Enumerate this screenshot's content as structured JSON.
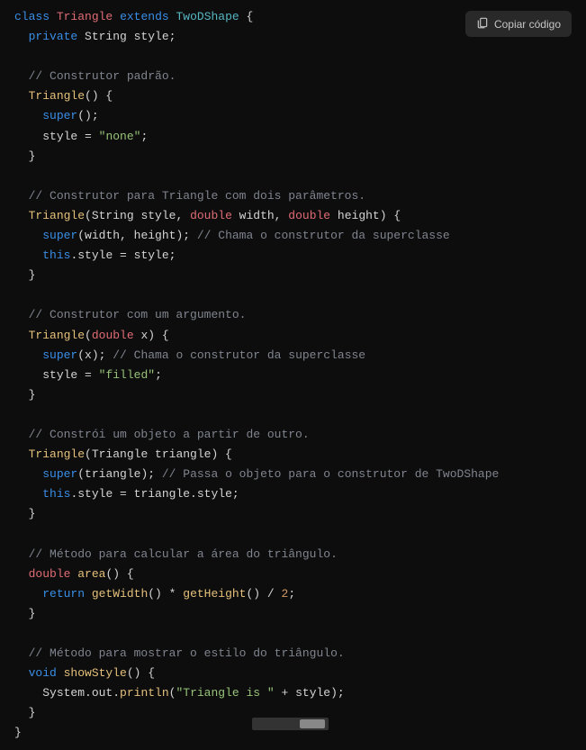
{
  "copyButton": {
    "label": "Copiar código"
  },
  "code": {
    "line1_keyword_class": "class",
    "line1_classname": "Triangle",
    "line1_keyword_extends": "extends",
    "line1_extendsname": "TwoDShape",
    "line1_brace": " {",
    "line2_keyword": "private",
    "line2_type": " String",
    "line2_rest": " style;",
    "line4_comment": "// Construtor padrão.",
    "line5_method": "Triangle",
    "line5_rest": "() {",
    "line6_super": "super",
    "line6_rest": "();",
    "line7_pre": "style = ",
    "line7_string": "\"none\"",
    "line7_post": ";",
    "line8_brace": "}",
    "line10_comment": "// Construtor para Triangle com dois parâmetros.",
    "line11_method": "Triangle",
    "line11_p1": "(String style, ",
    "line11_double1": "double",
    "line11_p2": " width, ",
    "line11_double2": "double",
    "line11_p3": " height) {",
    "line12_super": "super",
    "line12_args": "(width, height); ",
    "line12_comment": "// Chama o construtor da superclasse",
    "line13_this": "this",
    "line13_rest": ".style = style;",
    "line14_brace": "}",
    "line16_comment": "// Construtor com um argumento.",
    "line17_method": "Triangle",
    "line17_p1": "(",
    "line17_double": "double",
    "line17_p2": " x) {",
    "line18_super": "super",
    "line18_args": "(x); ",
    "line18_comment": "// Chama o construtor da superclasse",
    "line19_pre": "style = ",
    "line19_string": "\"filled\"",
    "line19_post": ";",
    "line20_brace": "}",
    "line22_comment": "// Constrói um objeto a partir de outro.",
    "line23_method": "Triangle",
    "line23_rest": "(Triangle triangle) {",
    "line24_super": "super",
    "line24_args": "(triangle); ",
    "line24_comment": "// Passa o objeto para o construtor de TwoDShape",
    "line25_this": "this",
    "line25_rest": ".style = triangle.style;",
    "line26_brace": "}",
    "line28_comment": "// Método para calcular a área do triângulo.",
    "line29_double": "double",
    "line29_method": " area",
    "line29_rest": "() {",
    "line30_return": "return",
    "line30_call1": " getWidth",
    "line30_p1": "() * ",
    "line30_call2": "getHeight",
    "line30_p2": "() / ",
    "line30_num": "2",
    "line30_semi": ";",
    "line31_brace": "}",
    "line33_comment": "// Método para mostrar o estilo do triângulo.",
    "line34_void": "void",
    "line34_method": " showStyle",
    "line34_rest": "() {",
    "line35_pre": "System.out.",
    "line35_println": "println",
    "line35_p1": "(",
    "line35_string": "\"Triangle is \"",
    "line35_p2": " + style);",
    "line36_brace": "}",
    "line37_brace": "}"
  }
}
